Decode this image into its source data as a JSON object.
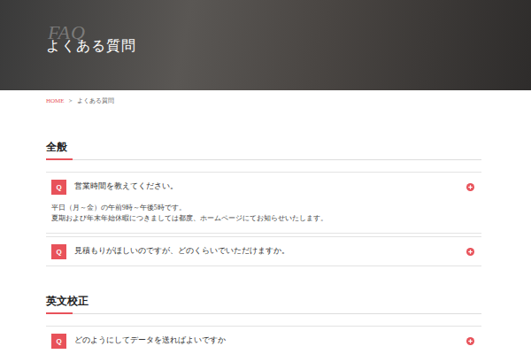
{
  "hero": {
    "overlay_title": "FAQ",
    "title": "よくある質問"
  },
  "breadcrumb": {
    "items": [
      {
        "label": "HOME",
        "link": true
      },
      {
        "label": "よくある質問",
        "link": false
      }
    ],
    "separator": ">"
  },
  "badge": "Q",
  "sections": [
    {
      "title": "全般",
      "items": [
        {
          "question": "営業時間を教えてください。",
          "expanded": true,
          "answer": [
            "平日（月～金）の午前9時～午後5時です。",
            "夏期および年末年始休暇につきましては都度、ホームページにてお知らせいたします。"
          ]
        },
        {
          "question": "見積もりがほしいのですが、どのくらいでいただけますか。",
          "expanded": false,
          "answer": []
        }
      ]
    },
    {
      "title": "英文校正",
      "items": [
        {
          "question": "どのようにしてデータを送ればよいですか",
          "expanded": false,
          "answer": []
        }
      ]
    }
  ]
}
